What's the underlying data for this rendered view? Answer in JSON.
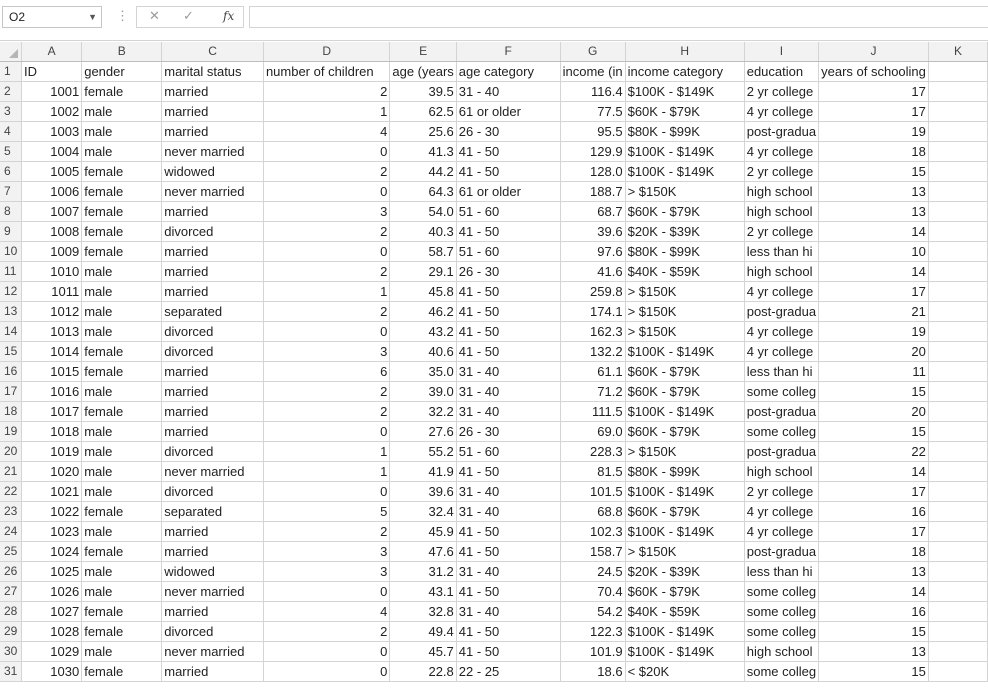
{
  "formula_bar": {
    "name_box": "O2",
    "cancel_glyph": "✕",
    "enter_glyph": "✓",
    "fx_label": "fx",
    "formula": ""
  },
  "column_headers": [
    "A",
    "B",
    "C",
    "D",
    "E",
    "F",
    "G",
    "H",
    "I",
    "J",
    "K"
  ],
  "header_row": [
    "ID",
    "gender",
    "marital status",
    "number of children",
    "age (years",
    "age category",
    "income (in",
    "income category",
    "education",
    "years of schooling",
    ""
  ],
  "rows": [
    [
      "1001",
      "female",
      "married",
      "2",
      "39.5",
      "31 - 40",
      "116.4",
      "$100K - $149K",
      "2 yr college",
      "17"
    ],
    [
      "1002",
      "male",
      "married",
      "1",
      "62.5",
      "61 or older",
      "77.5",
      "$60K - $79K",
      "4 yr college",
      "17"
    ],
    [
      "1003",
      "male",
      "married",
      "4",
      "25.6",
      "26 - 30",
      "95.5",
      "$80K - $99K",
      "post-gradua",
      "19"
    ],
    [
      "1004",
      "male",
      "never married",
      "0",
      "41.3",
      "41 - 50",
      "129.9",
      "$100K - $149K",
      "4 yr college",
      "18"
    ],
    [
      "1005",
      "female",
      "widowed",
      "2",
      "44.2",
      "41 - 50",
      "128.0",
      "$100K - $149K",
      "2 yr college",
      "15"
    ],
    [
      "1006",
      "female",
      "never married",
      "0",
      "64.3",
      "61 or older",
      "188.7",
      "> $150K",
      "high school",
      "13"
    ],
    [
      "1007",
      "female",
      "married",
      "3",
      "54.0",
      "51 - 60",
      "68.7",
      "$60K - $79K",
      "high school",
      "13"
    ],
    [
      "1008",
      "female",
      "divorced",
      "2",
      "40.3",
      "41 - 50",
      "39.6",
      "$20K - $39K",
      "2 yr college",
      "14"
    ],
    [
      "1009",
      "female",
      "married",
      "0",
      "58.7",
      "51 - 60",
      "97.6",
      "$80K - $99K",
      "less than hi",
      "10"
    ],
    [
      "1010",
      "male",
      "married",
      "2",
      "29.1",
      "26 - 30",
      "41.6",
      "$40K - $59K",
      "high school",
      "14"
    ],
    [
      "1011",
      "male",
      "married",
      "1",
      "45.8",
      "41 - 50",
      "259.8",
      "> $150K",
      "4 yr college",
      "17"
    ],
    [
      "1012",
      "male",
      "separated",
      "2",
      "46.2",
      "41 - 50",
      "174.1",
      "> $150K",
      "post-gradua",
      "21"
    ],
    [
      "1013",
      "male",
      "divorced",
      "0",
      "43.2",
      "41 - 50",
      "162.3",
      "> $150K",
      "4 yr college",
      "19"
    ],
    [
      "1014",
      "female",
      "divorced",
      "3",
      "40.6",
      "41 - 50",
      "132.2",
      "$100K - $149K",
      "4 yr college",
      "20"
    ],
    [
      "1015",
      "female",
      "married",
      "6",
      "35.0",
      "31 - 40",
      "61.1",
      "$60K - $79K",
      "less than hi",
      "11"
    ],
    [
      "1016",
      "male",
      "married",
      "2",
      "39.0",
      "31 - 40",
      "71.2",
      "$60K - $79K",
      "some colleg",
      "15"
    ],
    [
      "1017",
      "female",
      "married",
      "2",
      "32.2",
      "31 - 40",
      "111.5",
      "$100K - $149K",
      "post-gradua",
      "20"
    ],
    [
      "1018",
      "male",
      "married",
      "0",
      "27.6",
      "26 - 30",
      "69.0",
      "$60K - $79K",
      "some colleg",
      "15"
    ],
    [
      "1019",
      "male",
      "divorced",
      "1",
      "55.2",
      "51 - 60",
      "228.3",
      "> $150K",
      "post-gradua",
      "22"
    ],
    [
      "1020",
      "male",
      "never married",
      "1",
      "41.9",
      "41 - 50",
      "81.5",
      "$80K - $99K",
      "high school",
      "14"
    ],
    [
      "1021",
      "male",
      "divorced",
      "0",
      "39.6",
      "31 - 40",
      "101.5",
      "$100K - $149K",
      "2 yr college",
      "17"
    ],
    [
      "1022",
      "female",
      "separated",
      "5",
      "32.4",
      "31 - 40",
      "68.8",
      "$60K - $79K",
      "4 yr college",
      "16"
    ],
    [
      "1023",
      "male",
      "married",
      "2",
      "45.9",
      "41 - 50",
      "102.3",
      "$100K - $149K",
      "4 yr college",
      "17"
    ],
    [
      "1024",
      "female",
      "married",
      "3",
      "47.6",
      "41 - 50",
      "158.7",
      "> $150K",
      "post-gradua",
      "18"
    ],
    [
      "1025",
      "male",
      "widowed",
      "3",
      "31.2",
      "31 - 40",
      "24.5",
      "$20K - $39K",
      "less than hi",
      "13"
    ],
    [
      "1026",
      "male",
      "never married",
      "0",
      "43.1",
      "41 - 50",
      "70.4",
      "$60K - $79K",
      "some colleg",
      "14"
    ],
    [
      "1027",
      "female",
      "married",
      "4",
      "32.8",
      "31 - 40",
      "54.2",
      "$40K - $59K",
      "some colleg",
      "16"
    ],
    [
      "1028",
      "female",
      "divorced",
      "2",
      "49.4",
      "41 - 50",
      "122.3",
      "$100K - $149K",
      "some colleg",
      "15"
    ],
    [
      "1029",
      "male",
      "never married",
      "0",
      "45.7",
      "41 - 50",
      "101.9",
      "$100K - $149K",
      "high school",
      "13"
    ],
    [
      "1030",
      "female",
      "married",
      "0",
      "22.8",
      "22 - 25",
      "18.6",
      "< $20K",
      "some colleg",
      "15"
    ]
  ]
}
